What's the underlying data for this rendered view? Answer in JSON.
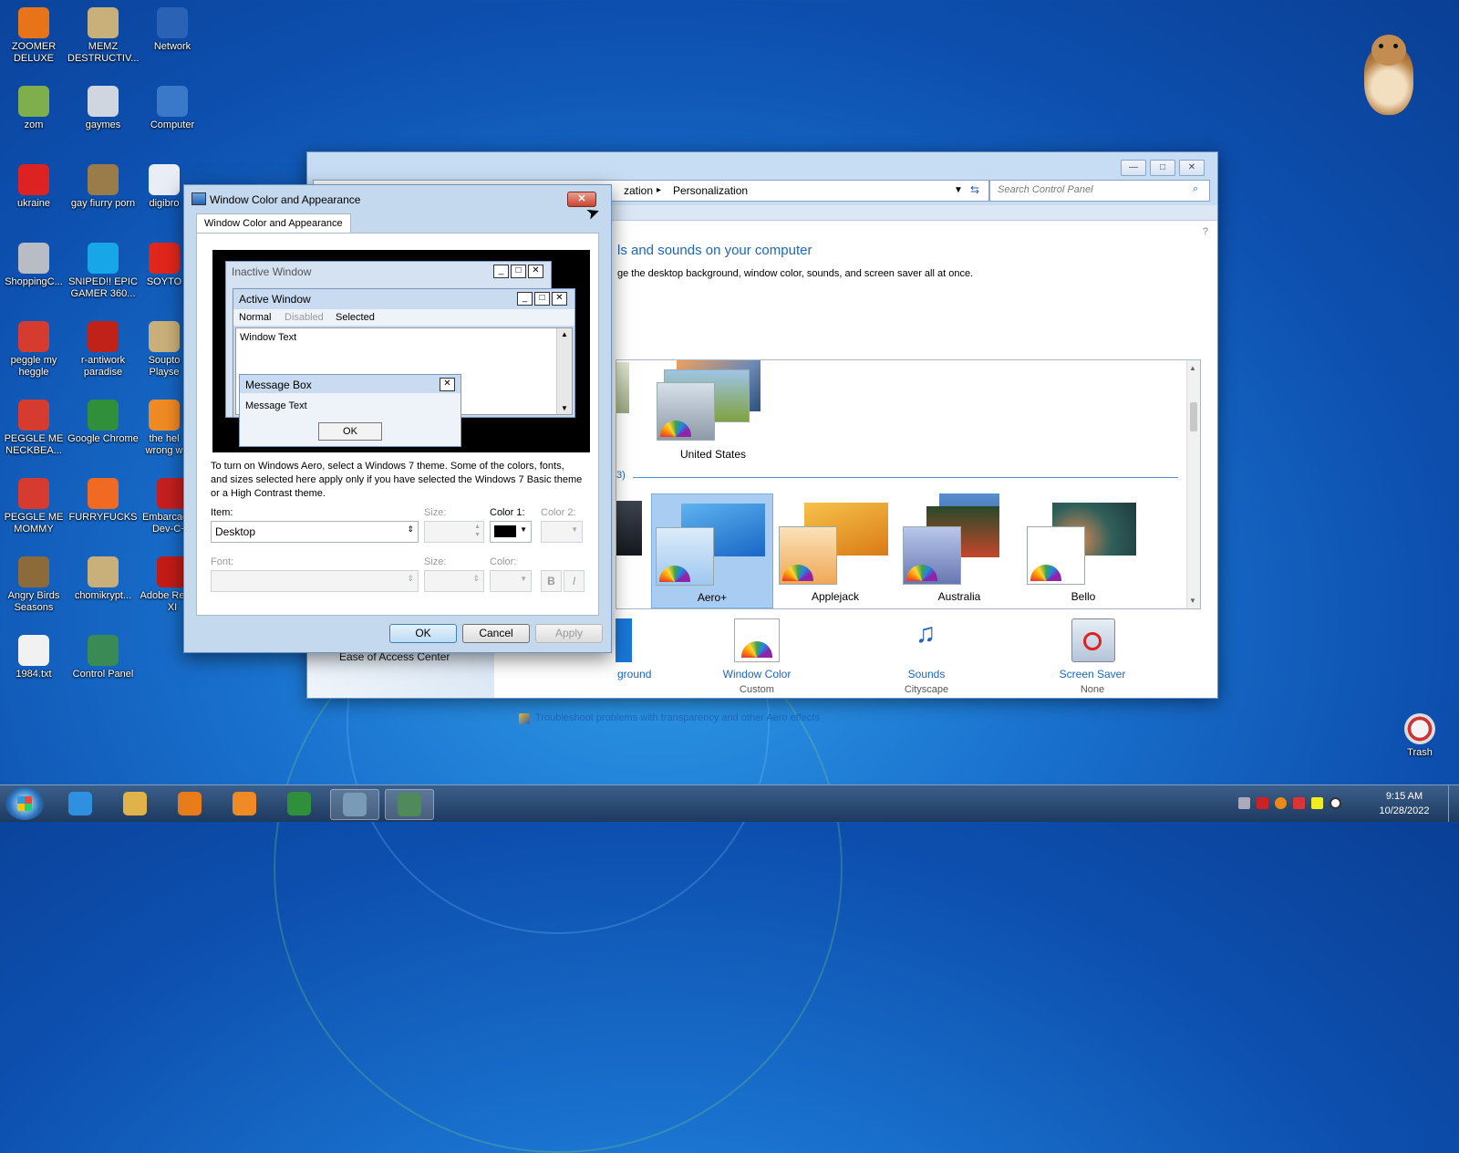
{
  "desktop": {
    "icons": [
      {
        "label": "ZOOMER DELUXE",
        "icon": "zoomer-icon",
        "color": "#e8741a"
      },
      {
        "label": "MEMZ DESTRUCTIV...",
        "icon": "memz-icon",
        "color": "#c9b07a"
      },
      {
        "label": "Network",
        "icon": "network-icon",
        "color": "#2a62b5"
      },
      {
        "label": "zom",
        "icon": "zom-icon",
        "color": "#7fae4c"
      },
      {
        "label": "gaymes",
        "icon": "gaymes-icon",
        "color": "#cfd6e0"
      },
      {
        "label": "Computer",
        "icon": "computer-icon",
        "color": "#3a78c9"
      },
      {
        "label": "ukraine",
        "icon": "radiation-icon",
        "color": "#d22"
      },
      {
        "label": "gay fiurry porn",
        "icon": "box-icon",
        "color": "#9a7b4a"
      },
      {
        "label": "digibro",
        "icon": "digibro-icon",
        "color": "#e9eef6"
      },
      {
        "label": "ShoppingC...",
        "icon": "flash-icon",
        "color": "#b8bcc4"
      },
      {
        "label": "SNIPED!! EPIC GAMER 360...",
        "icon": "skype-icon",
        "color": "#17a7e8"
      },
      {
        "label": "SOYTO",
        "icon": "soyto-icon",
        "color": "#e1261c"
      },
      {
        "label": "peggle my heggle",
        "icon": "peggle-icon",
        "color": "#d63b2f"
      },
      {
        "label": "r-antiwork paradise",
        "icon": "antiwork-icon",
        "color": "#c0221a"
      },
      {
        "label": "Soupto Playse",
        "icon": "soupto-icon",
        "color": "#c9b07a"
      },
      {
        "label": "PEGGLE ME NECKBEA...",
        "icon": "peggle-icon",
        "color": "#d63b2f"
      },
      {
        "label": "Google Chrome",
        "icon": "chrome-icon",
        "color": "#2f8f3b"
      },
      {
        "label": "the hel wrong w",
        "icon": "firefox-icon",
        "color": "#f08a24"
      },
      {
        "label": "PEGGLE ME MOMMY",
        "icon": "peggle-icon",
        "color": "#d63b2f"
      },
      {
        "label": "FURRYFUCKS",
        "icon": "firefox-icon",
        "color": "#f06a24"
      },
      {
        "label": "Embarcadero Dev-C++",
        "icon": "devcpp-icon",
        "color": "#c51f1f"
      },
      {
        "label": "Angry Birds Seasons",
        "icon": "angry-birds-icon",
        "color": "#8c6a3a"
      },
      {
        "label": "chomikrypt...",
        "icon": "chomik-icon",
        "color": "#c9b07a"
      },
      {
        "label": "Adobe Reader XI",
        "icon": "adobe-reader-icon",
        "color": "#c41b16"
      },
      {
        "label": "1984.txt",
        "icon": "text-file-icon",
        "color": "#f1f1f1"
      },
      {
        "label": "Control Panel",
        "icon": "control-panel-icon",
        "color": "#3a8a55"
      }
    ],
    "trash_label": "Trash"
  },
  "control_panel": {
    "breadcrumb_partial": "zation",
    "breadcrumb_sep": "▸",
    "breadcrumb_current": "Personalization",
    "search_placeholder": "Search Control Panel",
    "heading": "ls and sounds on your computer",
    "subheading": "ge the desktop background, window color, sounds, and screen saver all at once.",
    "section_count": "3)",
    "themes_top": [
      {
        "label": "United States"
      }
    ],
    "themes": [
      {
        "label": "Aero+",
        "selected": true
      },
      {
        "label": "Applejack"
      },
      {
        "label": "Australia"
      },
      {
        "label": "Bello"
      }
    ],
    "bottom_links": [
      {
        "label": "ground",
        "sub": ""
      },
      {
        "label": "Window Color",
        "sub": "Custom"
      },
      {
        "label": "Sounds",
        "sub": "Cityscape"
      },
      {
        "label": "Screen Saver",
        "sub": "None"
      }
    ],
    "left_link": "Ease of Access Center",
    "troubleshoot": "Troubleshoot problems with transparency and other Aero effects"
  },
  "dialog": {
    "title": "Window Color and Appearance",
    "tab": "Window Color and Appearance",
    "preview": {
      "inactive": "Inactive Window",
      "active": "Active Window",
      "menu_normal": "Normal",
      "menu_disabled": "Disabled",
      "menu_selected": "Selected",
      "window_text": "Window Text",
      "msgbox_title": "Message Box",
      "msgbox_text": "Message Text",
      "msgbox_ok": "OK"
    },
    "info": "To turn on Windows Aero, select a Windows 7 theme.  Some of the colors, fonts, and sizes selected here apply only if you have selected the Windows 7 Basic theme or a High Contrast theme.",
    "item_label": "Item:",
    "item_value": "Desktop",
    "size_label": "Size:",
    "color1_label": "Color 1:",
    "color2_label": "Color 2:",
    "color1_value": "#000000",
    "font_label": "Font:",
    "font_size_label": "Size:",
    "font_color_label": "Color:",
    "bold": "B",
    "italic": "I",
    "ok": "OK",
    "cancel": "Cancel",
    "apply": "Apply"
  },
  "taskbar": {
    "time": "9:15 AM",
    "date": "10/28/2022",
    "items": [
      "ie-icon",
      "explorer-icon",
      "media-player-icon",
      "firefox-taskbar-icon",
      "chrome-taskbar-icon",
      "control-panel-taskbar-icon",
      "personalization-taskbar-icon"
    ]
  }
}
